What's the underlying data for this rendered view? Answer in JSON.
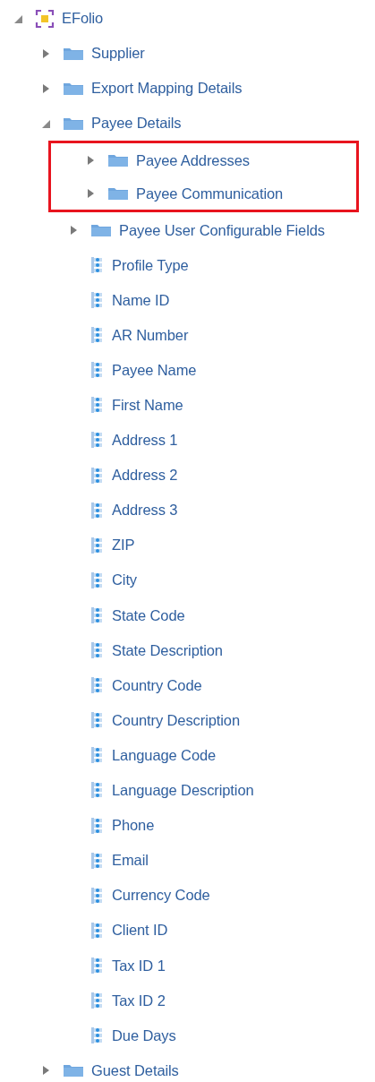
{
  "tree": [
    {
      "kind": "root",
      "label": "EFolio",
      "expanded": true,
      "children": [
        {
          "kind": "folder",
          "label": "Supplier",
          "expanded": false
        },
        {
          "kind": "folder",
          "label": "Export Mapping Details",
          "expanded": false
        },
        {
          "kind": "folder",
          "label": "Payee Details",
          "expanded": true,
          "children": [
            {
              "kind": "folder",
              "label": "Payee Addresses",
              "expanded": false,
              "highlighted": true
            },
            {
              "kind": "folder",
              "label": "Payee Communication",
              "expanded": false,
              "highlighted": true
            },
            {
              "kind": "folder",
              "label": "Payee User Configurable Fields",
              "expanded": false,
              "highlighted": false
            },
            {
              "kind": "field",
              "label": "Profile Type",
              "highlighted": false
            },
            {
              "kind": "field",
              "label": "Name ID",
              "highlighted": false
            },
            {
              "kind": "field",
              "label": "AR Number",
              "highlighted": false
            },
            {
              "kind": "field",
              "label": "Payee Name",
              "highlighted": false
            },
            {
              "kind": "field",
              "label": "First Name",
              "highlighted": false
            },
            {
              "kind": "field",
              "label": "Address 1",
              "highlighted": false
            },
            {
              "kind": "field",
              "label": "Address 2",
              "highlighted": false
            },
            {
              "kind": "field",
              "label": "Address 3",
              "highlighted": false
            },
            {
              "kind": "field",
              "label": "ZIP",
              "highlighted": false
            },
            {
              "kind": "field",
              "label": "City",
              "highlighted": false
            },
            {
              "kind": "field",
              "label": "State Code",
              "highlighted": false
            },
            {
              "kind": "field",
              "label": "State Description",
              "highlighted": false
            },
            {
              "kind": "field",
              "label": "Country Code",
              "highlighted": false
            },
            {
              "kind": "field",
              "label": "Country Description",
              "highlighted": false
            },
            {
              "kind": "field",
              "label": "Language Code",
              "highlighted": false
            },
            {
              "kind": "field",
              "label": "Language Description",
              "highlighted": false
            },
            {
              "kind": "field",
              "label": "Phone",
              "highlighted": false
            },
            {
              "kind": "field",
              "label": "Email",
              "highlighted": false
            },
            {
              "kind": "field",
              "label": "Currency Code",
              "highlighted": false
            },
            {
              "kind": "field",
              "label": "Client ID",
              "highlighted": false
            },
            {
              "kind": "field",
              "label": "Tax ID 1",
              "highlighted": false
            },
            {
              "kind": "field",
              "label": "Tax ID 2",
              "highlighted": false
            },
            {
              "kind": "field",
              "label": "Due Days",
              "highlighted": false
            }
          ]
        },
        {
          "kind": "folder",
          "label": "Guest Details",
          "expanded": false
        }
      ]
    }
  ]
}
